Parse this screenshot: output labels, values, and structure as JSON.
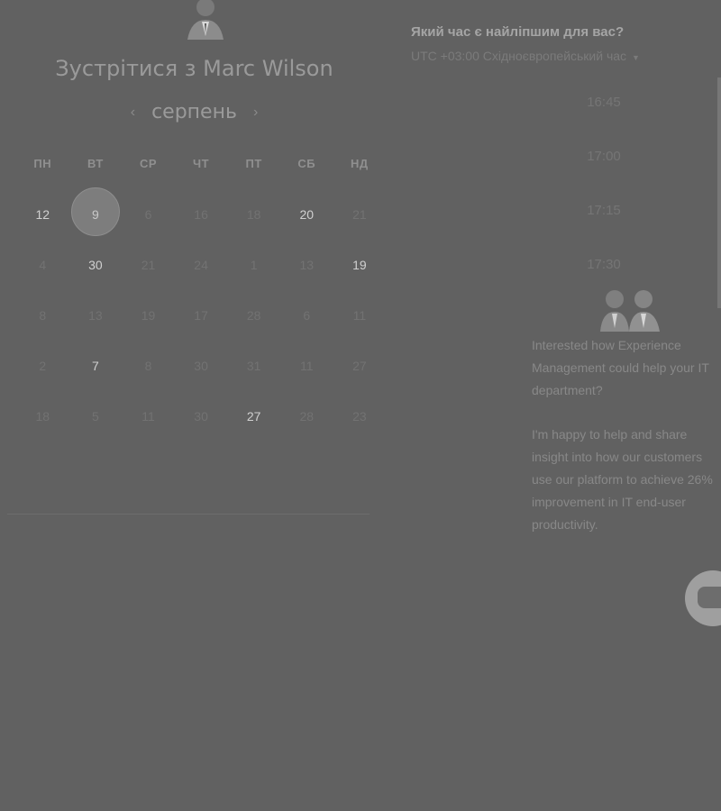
{
  "host": {
    "title": "Зустрітися з Marc Wilson"
  },
  "calendar": {
    "month": "серпень",
    "prev_arrow": "‹",
    "next_arrow": "›",
    "weekdays": [
      "ПН",
      "ВТ",
      "СР",
      "ЧТ",
      "ПТ",
      "СБ",
      "НД"
    ],
    "weeks": [
      [
        "12",
        "9",
        "6",
        "16",
        "18",
        "20",
        "21"
      ],
      [
        "4",
        "30",
        "21",
        "24",
        "1",
        "13",
        "19"
      ],
      [
        "8",
        "13",
        "19",
        "17",
        "28",
        "6",
        "11"
      ],
      [
        "2",
        "7",
        "8",
        "30",
        "31",
        "11",
        "27"
      ],
      [
        "18",
        "5",
        "11",
        "30",
        "27",
        "28",
        "23"
      ]
    ],
    "selected_day": "9"
  },
  "scheduler": {
    "question": "Який час є найліпшим для вас?",
    "timezone": "UTC +03:00 Східноєвропейський час",
    "timezone_chevron": "▼",
    "slots": [
      "16:45",
      "17:00",
      "17:15",
      "17:30"
    ]
  },
  "promo": {
    "paragraph1": "Interested how Experience Management could help your IT department?",
    "paragraph2": "I'm happy to help and share insight into how our customers use our platform to achieve 26% improvement in IT end-user productivity."
  },
  "icons": {
    "chat": "chat-bubble-icon",
    "host_avatar": "person-avatar-icon",
    "team_avatars": "team-avatars-icon"
  },
  "colors": {
    "overlay": "#616161",
    "selected_ring": "#7d7d7d"
  }
}
